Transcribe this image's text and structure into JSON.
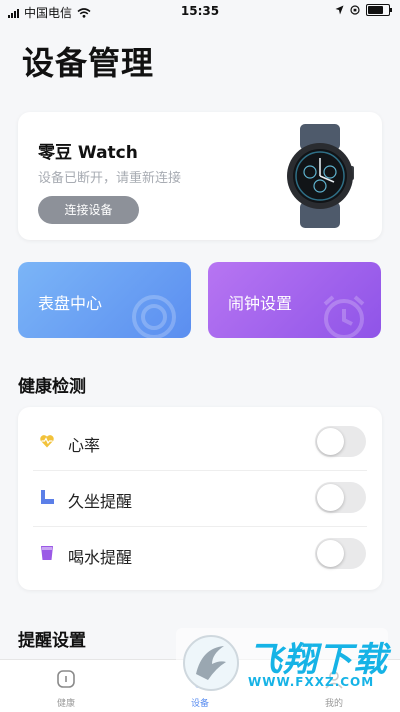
{
  "status_bar": {
    "carrier": "中国电信",
    "time": "15:35"
  },
  "page": {
    "title": "设备管理"
  },
  "device": {
    "name": "零豆 Watch",
    "status": "设备已断开，请重新连接",
    "connect_label": "连接设备",
    "image_icon": "smartwatch-image"
  },
  "tiles": [
    {
      "label": "表盘中心",
      "icon": "watch-dial-icon",
      "color_start": "#7bb5f7",
      "color_end": "#5b8ef0"
    },
    {
      "label": "闹钟设置",
      "icon": "alarm-clock-icon",
      "color_start": "#b775f2",
      "color_end": "#8f54e8"
    }
  ],
  "health": {
    "title": "健康检测",
    "items": [
      {
        "label": "心率",
        "icon": "heart-icon",
        "enabled": false
      },
      {
        "label": "久坐提醒",
        "icon": "sitting-icon",
        "enabled": false
      },
      {
        "label": "喝水提醒",
        "icon": "cup-icon",
        "enabled": false
      }
    ]
  },
  "reminder": {
    "title": "提醒设置"
  },
  "tabbar": {
    "active": 1,
    "items": [
      {
        "label": "健康",
        "icon": "health-icon"
      },
      {
        "label": "设备",
        "icon": "device-icon"
      },
      {
        "label": "我的",
        "icon": "profile-icon"
      }
    ]
  },
  "watermark": {
    "brand": "飞翔下载",
    "url": "WWW.FXXZ.COM"
  },
  "colors": {
    "accent": "#5b8ef0",
    "purple": "#8f54e8",
    "heart": "#f2c23a",
    "sitting": "#5b7fe8",
    "cup": "#9b59e6"
  }
}
